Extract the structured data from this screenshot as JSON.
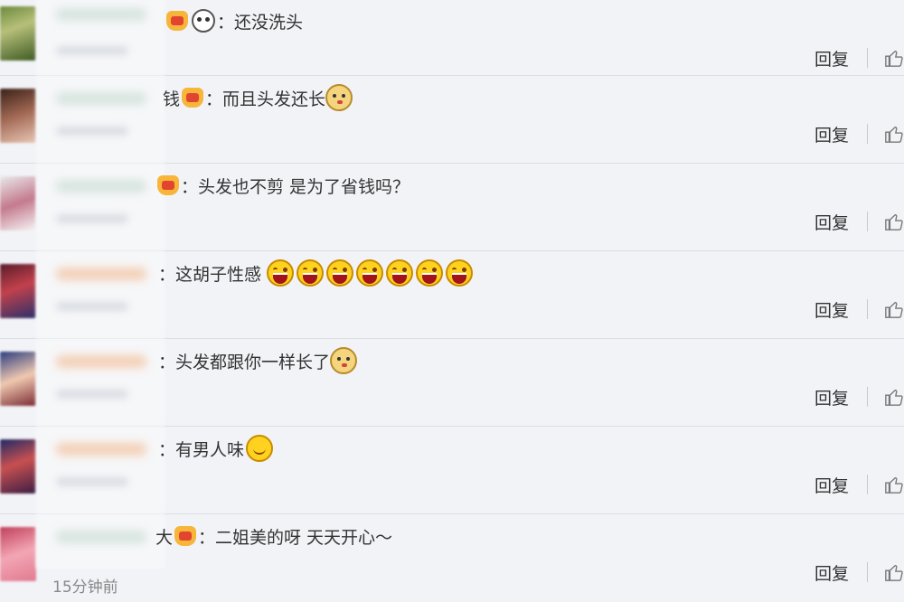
{
  "comments": [
    {
      "text_before": "：还没洗头",
      "reply_label": "回复",
      "emoji": [
        "vip",
        "panda"
      ]
    },
    {
      "prefix": "钱",
      "text": "：而且头发还长",
      "reply_label": "回复"
    },
    {
      "text": "：头发也不剪 是为了省钱吗？",
      "reply_label": "回复"
    },
    {
      "text": "：这胡子性感",
      "reply_label": "回复",
      "laugh_count": 7
    },
    {
      "text": "：头发都跟你一样长了",
      "reply_label": "回复"
    },
    {
      "text": "：有男人味",
      "reply_label": "回复"
    },
    {
      "prefix": "大",
      "text": "：二姐美的呀 天天开心～",
      "reply_label": "回复"
    }
  ],
  "footer": {
    "timestamp": "15分钟前"
  },
  "icons": {
    "like": "thumbs-up-icon",
    "vip": "vip-crown-icon",
    "panda": "panda-emoji-icon",
    "doge": "doge-emoji-icon",
    "laugh": "laugh-emoji-icon",
    "smile": "smile-emoji-icon"
  },
  "colors": {
    "background": "#f2f3f7",
    "text": "#333333",
    "muted": "#888888",
    "divider": "#dcdde2"
  }
}
